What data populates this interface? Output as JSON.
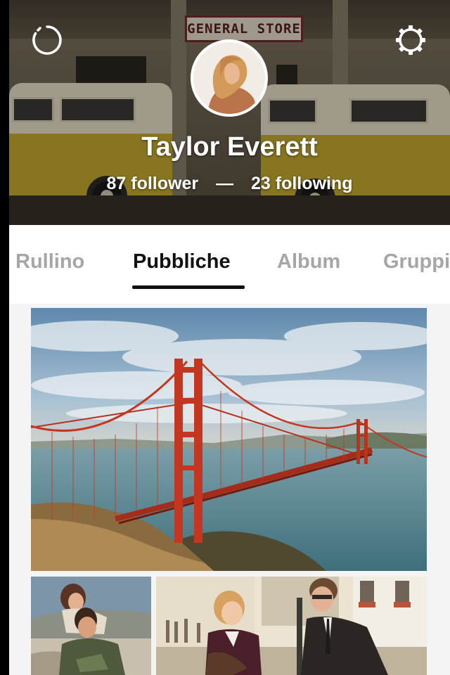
{
  "header": {
    "sign_text": "GENERAL STORE",
    "user_name": "Taylor Everett",
    "followers": "87 follower",
    "separator": "—",
    "following": "23 following",
    "left_icon": "refresh-icon",
    "right_icon": "gear-icon"
  },
  "tabs": [
    {
      "label": "Rullino",
      "active": false
    },
    {
      "label": "Pubbliche",
      "active": true
    },
    {
      "label": "Album",
      "active": false
    },
    {
      "label": "Gruppi",
      "active": false
    }
  ],
  "photos": [
    {
      "subject": "golden-gate-bridge"
    },
    {
      "subject": "couple-piggyback"
    },
    {
      "subject": "couple-street"
    }
  ],
  "colors": {
    "active_tab": "#111111",
    "inactive_tab": "#a6a6a6",
    "bridge": "#c4361f"
  }
}
